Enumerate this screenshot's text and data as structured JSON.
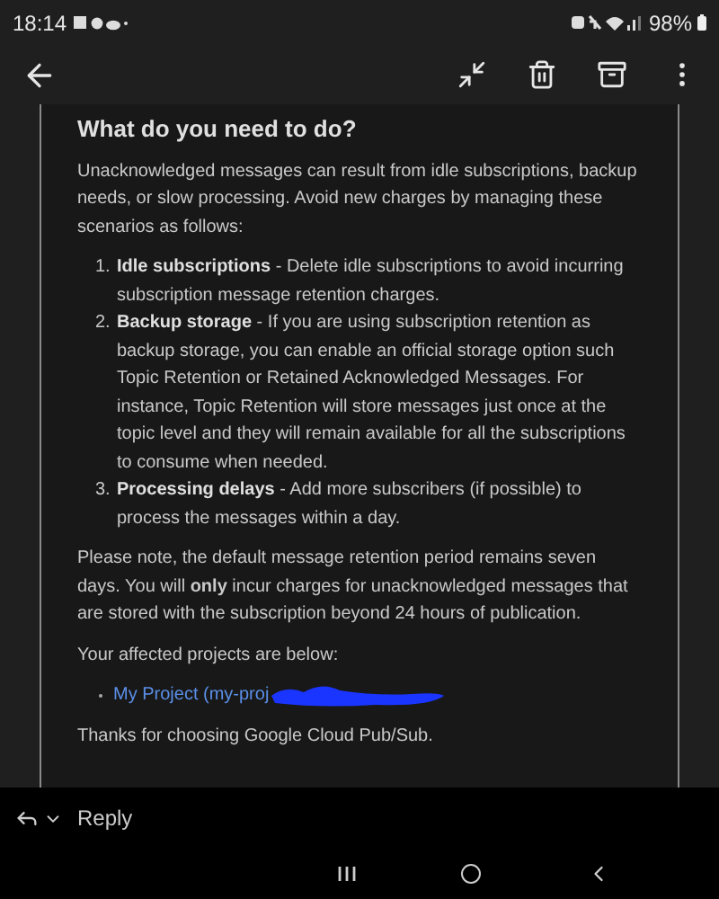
{
  "status_bar": {
    "time": "18:14",
    "battery": "98%"
  },
  "email": {
    "heading": "What do you need to do?",
    "intro": "Unacknowledged messages can result from idle subscriptions, backup needs, or slow processing. Avoid new charges by managing these scenarios as follows:",
    "steps": [
      {
        "number": "1.",
        "title": "Idle subscriptions",
        "text": " - Delete idle subscriptions to avoid incurring subscription message retention charges."
      },
      {
        "number": "2.",
        "title": "Backup storage",
        "text": " - If you are using subscription retention as backup storage, you can enable an official storage option such Topic Retention or Retained Acknowledged Messages. For instance, Topic Retention will store messages just once at the topic level and they will remain available for all the subscriptions to consume when needed."
      },
      {
        "number": "3.",
        "title": "Processing delays",
        "text": " - Add more subscribers (if possible) to process the messages within a day."
      }
    ],
    "note": "Please note, the default message retention period remains seven days. You will **only** incur charges for unacknowledged messages that are stored with the subscription beyond 24 hours of publication.",
    "projects_label": "Your affected projects are below:",
    "projects": [
      {
        "name": "My Project (my-proj",
        "redacted": true
      }
    ],
    "closing": "Thanks for choosing Google Cloud Pub/Sub."
  },
  "reply_bar": {
    "label": "Reply"
  }
}
